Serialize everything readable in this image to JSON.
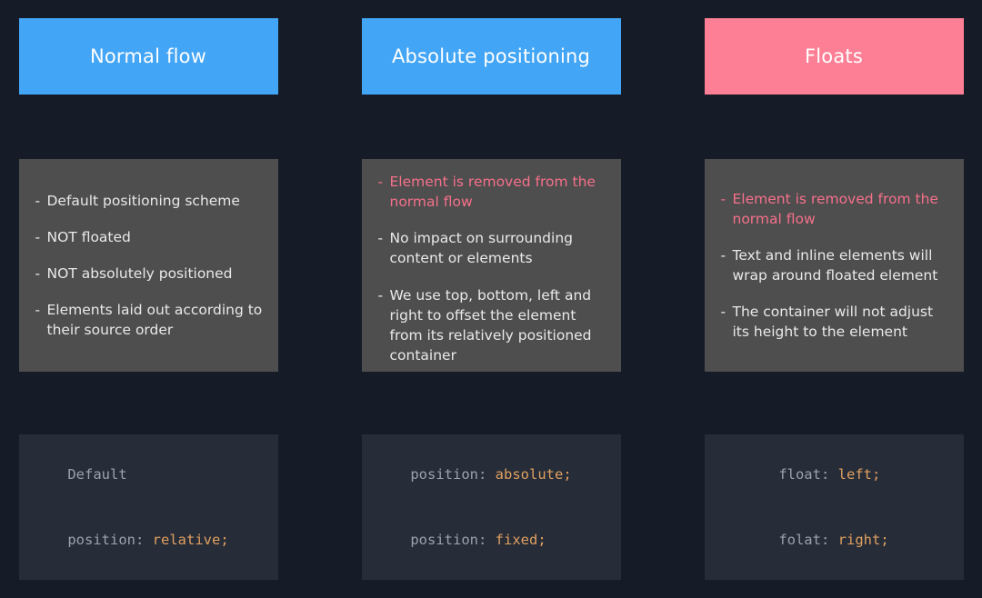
{
  "theme": {
    "background": "#161c27",
    "header_blue": "#42a5f5",
    "header_pink": "#fc7f95",
    "card_gray": "#4e4e4e",
    "code_bg": "#262c38",
    "text_light": "#e9e9e9",
    "text_accent": "#f4708a",
    "code_text": "#9aa3ad",
    "code_value": "#e0a060"
  },
  "columns": [
    {
      "header": {
        "title": "Normal flow",
        "style": "blue"
      },
      "bullets": [
        {
          "dash": "-",
          "text": "Default positioning scheme",
          "accent": false
        },
        {
          "dash": "-",
          "text": "NOT floated",
          "accent": false
        },
        {
          "dash": "-",
          "text": "NOT absolutely positioned",
          "accent": false
        },
        {
          "dash": "-",
          "text": "Elements laid out according to their source order",
          "accent": false
        }
      ],
      "code": [
        {
          "prop": "Default",
          "colon": "",
          "value": "",
          "semi": ""
        },
        {
          "prop": "position",
          "colon": ": ",
          "value": "relative",
          "semi": ";"
        }
      ]
    },
    {
      "header": {
        "title": "Absolute positioning",
        "style": "blue"
      },
      "bullets": [
        {
          "dash": "-",
          "text": "Element is removed from the normal flow",
          "accent": true
        },
        {
          "dash": "-",
          "text": "No impact on surrounding content or elements",
          "accent": false
        },
        {
          "dash": "-",
          "text": "We use top, bottom, left and right to offset the element from its relatively positioned container",
          "accent": false
        }
      ],
      "code": [
        {
          "prop": "position",
          "colon": ": ",
          "value": "absolute",
          "semi": ";"
        },
        {
          "prop": "position",
          "colon": ": ",
          "value": "fixed",
          "semi": ";"
        }
      ]
    },
    {
      "header": {
        "title": "Floats",
        "style": "pink"
      },
      "bullets": [
        {
          "dash": "-",
          "text": "Element is removed from the normal flow",
          "accent": true
        },
        {
          "dash": "-",
          "text": "Text and inline elements will wrap around floated element",
          "accent": false
        },
        {
          "dash": "-",
          "text": "The container will not adjust its height to the element",
          "accent": false
        }
      ],
      "code": [
        {
          "prop": "float",
          "colon": ": ",
          "value": "left",
          "semi": ";"
        },
        {
          "prop": "folat",
          "colon": ": ",
          "value": "right",
          "semi": ";"
        }
      ]
    }
  ]
}
